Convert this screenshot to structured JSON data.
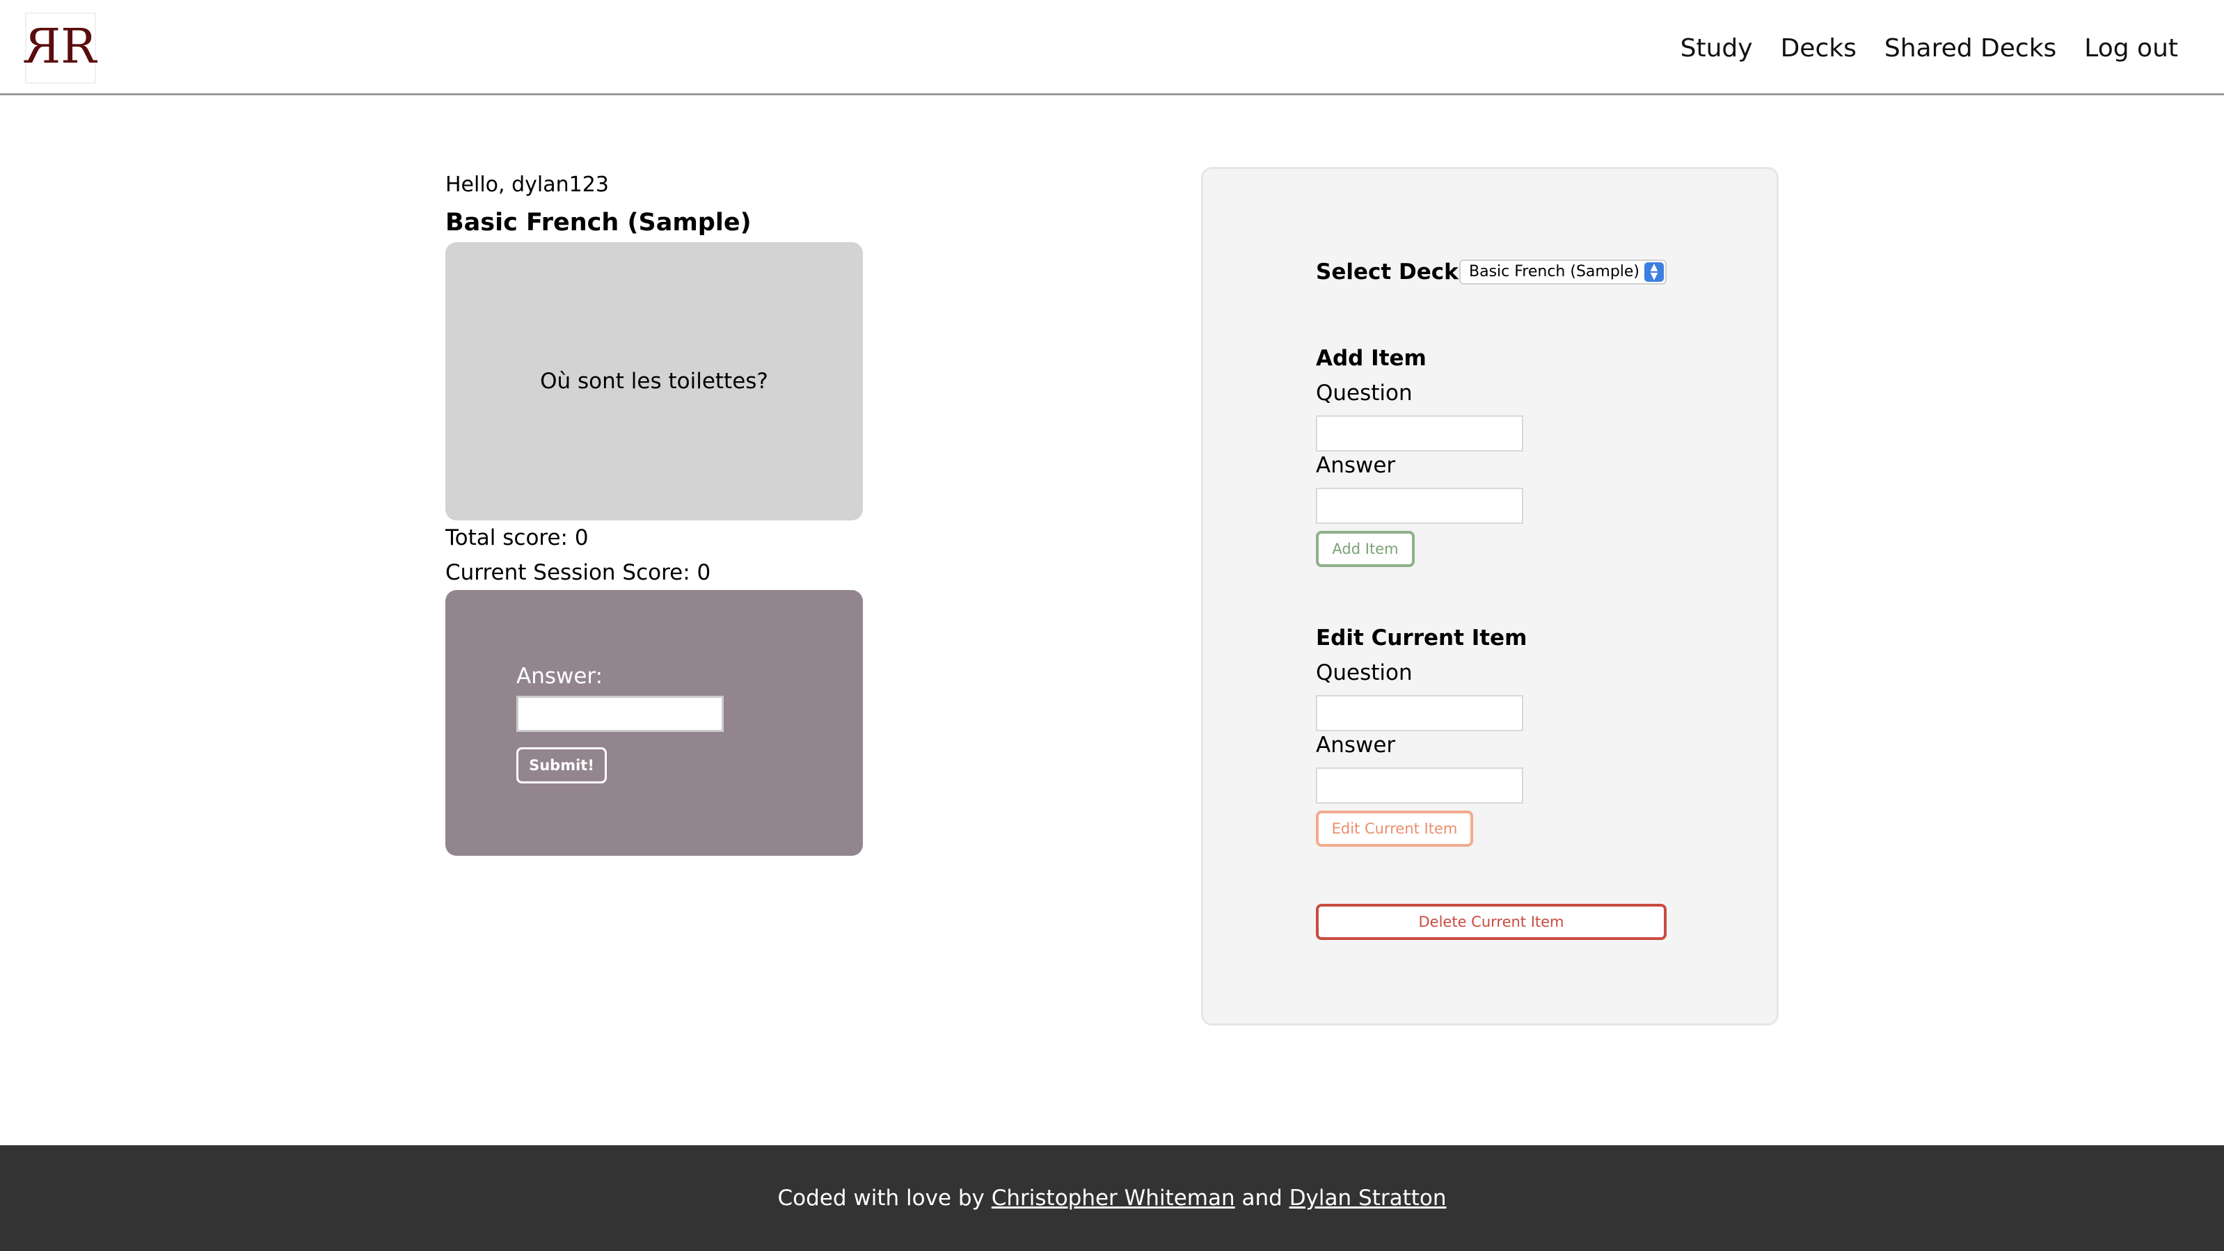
{
  "header": {
    "logo_alt": "RR",
    "nav": [
      "Study",
      "Decks",
      "Shared Decks",
      "Log out"
    ]
  },
  "study": {
    "greeting": "Hello, dylan123",
    "deck_title": "Basic French (Sample)",
    "card_question": "Où sont les toilettes?",
    "total_score": "Total score: 0",
    "session_score": "Current Session Score: 0",
    "answer_label": "Answer:",
    "answer_value": "",
    "submit_label": "Submit!"
  },
  "panel": {
    "select_label": "Select Deck:",
    "selected_deck": "Basic French (Sample)",
    "add_heading": "Add Item",
    "add_question_label": "Question",
    "add_answer_label": "Answer",
    "add_button": "Add Item",
    "edit_heading": "Edit Current Item",
    "edit_question_label": "Question",
    "edit_answer_label": "Answer",
    "edit_button": "Edit Current Item",
    "delete_button": "Delete Current Item"
  },
  "footer": {
    "prefix": "Coded with love by",
    "author1": "Christopher Whiteman",
    "conjunction": "and",
    "author2": "Dylan Stratton"
  },
  "colors": {
    "flashcard_bg": "#d3d3d3",
    "answer_panel_bg": "#93858d",
    "add_accent": "#8fb08a",
    "edit_accent": "#f2ab8e",
    "delete_accent": "#c94b40",
    "footer_bg": "#333333",
    "logo": "#5a0d0d"
  },
  "icons": {
    "logo": "rr-logo-icon",
    "select": "chevron-updown-icon"
  }
}
